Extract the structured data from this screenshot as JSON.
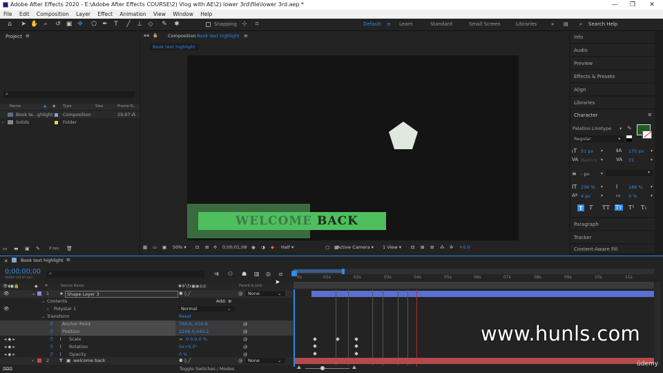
{
  "window": {
    "title": "Adobe After Effects 2020 - E:\\Adobe After Effects COURSE\\2) Vlog with AE\\2) lower 3rd\\file\\lower 3rd.aep *",
    "minimize": "—",
    "maximize": "❐",
    "close": "✕"
  },
  "menu": [
    "File",
    "Edit",
    "Composition",
    "Layer",
    "Effect",
    "Animation",
    "View",
    "Window",
    "Help"
  ],
  "toolbar": {
    "snapping": "Snapping",
    "workspaces": [
      "Default",
      "Learn",
      "Standard",
      "Small Screen",
      "Libraries"
    ],
    "active_workspace": "Default",
    "search_help": "Search Help"
  },
  "project": {
    "title": "Project",
    "columns": [
      "Name",
      "Type",
      "Size",
      "Frame R..."
    ],
    "items": [
      {
        "name": "Book te...ghlight",
        "type": "Composition",
        "fps": "29.97",
        "color": "#8ba5c8"
      },
      {
        "name": "Solids",
        "type": "Folder",
        "fps": "",
        "color": "#e8d44d"
      }
    ],
    "bpc": "8 bpc"
  },
  "composition": {
    "panel_title": "Composition",
    "comp_name": "Book text highlight",
    "tab": "Book text highlight",
    "lower_text_grey": "WELCOME ",
    "lower_text_dark": "BACK",
    "zoom": "50%",
    "timecode": "0;00;01;08",
    "resolution": "Half",
    "camera": "Active Camera",
    "views": "1 View",
    "exposure": "+0.0"
  },
  "right_panels": {
    "items_top": [
      "Info",
      "Audio",
      "Preview",
      "Effects & Presets",
      "Align",
      "Libraries"
    ],
    "character": {
      "title": "Character",
      "font": "Palatino Linotype",
      "style": "Regular",
      "size": "51 px",
      "leading": "175 px",
      "kerning": "Metrics",
      "tracking": "31",
      "stroke": "- px",
      "vscale": "236 %",
      "hscale": "186 %",
      "baseline": "4 px",
      "tsume": "0 %",
      "fill_color": "#1f5e1f"
    },
    "items_bottom": [
      "Paragraph",
      "Tracker",
      "Content-Aware Fill"
    ]
  },
  "timeline": {
    "tab": "Book text highlight",
    "timecode": "0;00;00;00",
    "timecode_sub": "00000 (29.97 fps)",
    "col_source": "Source Name",
    "col_parent": "Parent & Link",
    "ruler": [
      "0s",
      "01s",
      "02s",
      "03s",
      "04s",
      "05s",
      "06s",
      "07s",
      "08s",
      "09s",
      "10s",
      "11s"
    ],
    "layers": [
      {
        "num": "1",
        "name": "Shape Layer 3",
        "parent": "None"
      },
      {
        "num": "2",
        "name": "welcome back",
        "parent": "None"
      }
    ],
    "contents": "Contents",
    "add": "Add:",
    "polystar": "Polystar 1",
    "blend": "Normal",
    "transform": "Transform",
    "reset": "Reset",
    "props": [
      {
        "name": "Anchor Point",
        "value": "766.6,-434.8"
      },
      {
        "name": "Position",
        "value": "1248.0,440.2"
      },
      {
        "name": "Scale",
        "value": "0.0,0.0 %"
      },
      {
        "name": "Rotation",
        "value": "0x+0.0°"
      },
      {
        "name": "Opacity",
        "value": "0 %"
      }
    ],
    "toggle": "Toggle Switches / Modes"
  },
  "overlay": {
    "watermark": "www.hunls.com",
    "udemy": "ūdemy"
  }
}
